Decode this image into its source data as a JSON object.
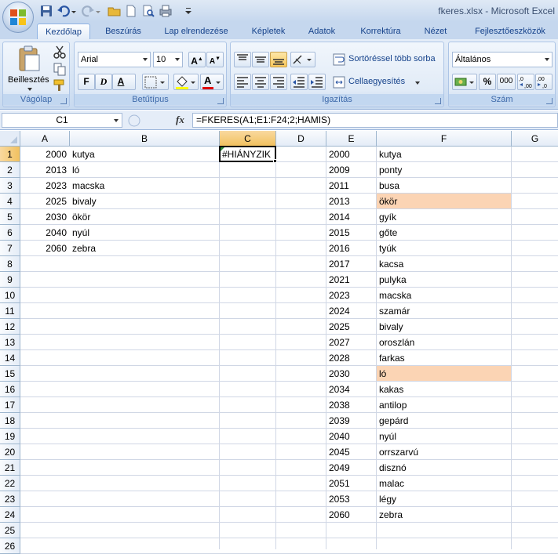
{
  "window": {
    "title": "fkeres.xlsx - Microsoft Excel"
  },
  "tabs": [
    "Kezdőlap",
    "Beszúrás",
    "Lap elrendezése",
    "Képletek",
    "Adatok",
    "Korrektúra",
    "Nézet",
    "Fejlesztőeszközök"
  ],
  "ribbon": {
    "clipboard": {
      "label": "Vágólap",
      "paste_label": "Beillesztés"
    },
    "font": {
      "label": "Betűtípus",
      "font_name": "Arial",
      "font_size": "10",
      "bold": "F",
      "italic": "D",
      "underline": "A",
      "font_color": "A"
    },
    "alignment": {
      "label": "Igazítás",
      "wrap_text": "Sortöréssel több sorba",
      "merge": "Cellaegyesítés"
    },
    "number": {
      "label": "Szám",
      "format": "Általános",
      "percent": "%",
      "thousands": "000"
    }
  },
  "formula_bar": {
    "name_box": "C1",
    "fx": "fx",
    "formula": "=FKERES(A1;E1:F24;2;HAMIS)"
  },
  "sheet": {
    "columns": [
      "A",
      "B",
      "C",
      "D",
      "E",
      "F",
      "G"
    ],
    "selected_column": "C",
    "rows": [
      "1",
      "2",
      "3",
      "4",
      "5",
      "6",
      "7",
      "8",
      "9",
      "10",
      "11",
      "12",
      "13",
      "14",
      "15",
      "16",
      "17",
      "18",
      "19",
      "20",
      "21",
      "22",
      "23",
      "24",
      "25",
      "26"
    ],
    "active_cell": "C1",
    "active_value": "#HIÁNYZIK",
    "col_a": [
      "2000",
      "2013",
      "2023",
      "2025",
      "2030",
      "2040",
      "2060"
    ],
    "col_b": [
      "kutya",
      "ló",
      "macska",
      "bivaly",
      "ökör",
      "nyúl",
      "zebra"
    ],
    "col_e": [
      "2000",
      "2009",
      "2011",
      "2013",
      "2014",
      "2015",
      "2016",
      "2017",
      "2021",
      "2023",
      "2024",
      "2025",
      "2027",
      "2028",
      "2030",
      "2034",
      "2038",
      "2039",
      "2040",
      "2045",
      "2049",
      "2051",
      "2053",
      "2060"
    ],
    "col_f": [
      "kutya",
      "ponty",
      "busa",
      "ökör",
      "gyík",
      "gőte",
      "tyúk",
      "kacsa",
      "pulyka",
      "macska",
      "szamár",
      "bivaly",
      "oroszlán",
      "farkas",
      "ló",
      "kakas",
      "antilop",
      "gepárd",
      "nyúl",
      "orrszarvú",
      "disznó",
      "malac",
      "légy",
      "zebra"
    ],
    "highlight_color": "#FBD4B4"
  }
}
